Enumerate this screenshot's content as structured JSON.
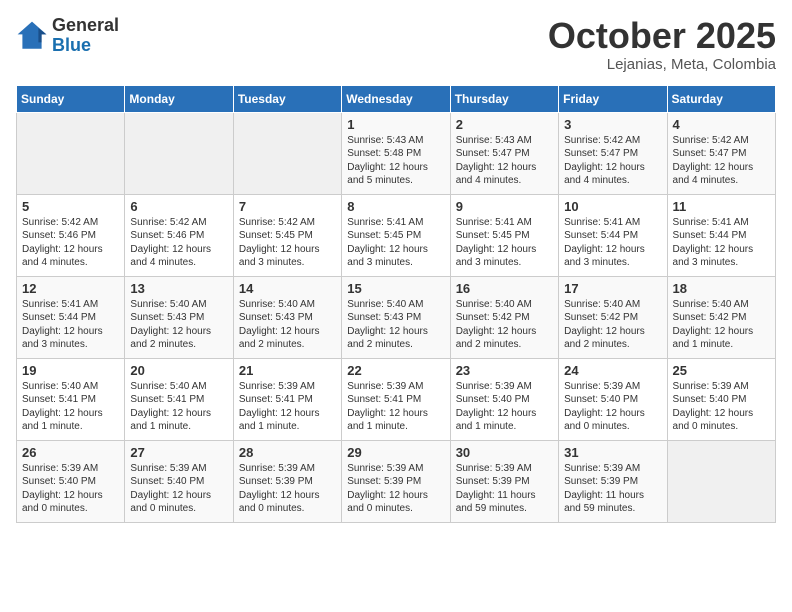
{
  "logo": {
    "general": "General",
    "blue": "Blue"
  },
  "header": {
    "month": "October 2025",
    "location": "Lejanias, Meta, Colombia"
  },
  "weekdays": [
    "Sunday",
    "Monday",
    "Tuesday",
    "Wednesday",
    "Thursday",
    "Friday",
    "Saturday"
  ],
  "weeks": [
    [
      {
        "day": "",
        "content": ""
      },
      {
        "day": "",
        "content": ""
      },
      {
        "day": "",
        "content": ""
      },
      {
        "day": "1",
        "content": "Sunrise: 5:43 AM\nSunset: 5:48 PM\nDaylight: 12 hours\nand 5 minutes."
      },
      {
        "day": "2",
        "content": "Sunrise: 5:43 AM\nSunset: 5:47 PM\nDaylight: 12 hours\nand 4 minutes."
      },
      {
        "day": "3",
        "content": "Sunrise: 5:42 AM\nSunset: 5:47 PM\nDaylight: 12 hours\nand 4 minutes."
      },
      {
        "day": "4",
        "content": "Sunrise: 5:42 AM\nSunset: 5:47 PM\nDaylight: 12 hours\nand 4 minutes."
      }
    ],
    [
      {
        "day": "5",
        "content": "Sunrise: 5:42 AM\nSunset: 5:46 PM\nDaylight: 12 hours\nand 4 minutes."
      },
      {
        "day": "6",
        "content": "Sunrise: 5:42 AM\nSunset: 5:46 PM\nDaylight: 12 hours\nand 4 minutes."
      },
      {
        "day": "7",
        "content": "Sunrise: 5:42 AM\nSunset: 5:45 PM\nDaylight: 12 hours\nand 3 minutes."
      },
      {
        "day": "8",
        "content": "Sunrise: 5:41 AM\nSunset: 5:45 PM\nDaylight: 12 hours\nand 3 minutes."
      },
      {
        "day": "9",
        "content": "Sunrise: 5:41 AM\nSunset: 5:45 PM\nDaylight: 12 hours\nand 3 minutes."
      },
      {
        "day": "10",
        "content": "Sunrise: 5:41 AM\nSunset: 5:44 PM\nDaylight: 12 hours\nand 3 minutes."
      },
      {
        "day": "11",
        "content": "Sunrise: 5:41 AM\nSunset: 5:44 PM\nDaylight: 12 hours\nand 3 minutes."
      }
    ],
    [
      {
        "day": "12",
        "content": "Sunrise: 5:41 AM\nSunset: 5:44 PM\nDaylight: 12 hours\nand 3 minutes."
      },
      {
        "day": "13",
        "content": "Sunrise: 5:40 AM\nSunset: 5:43 PM\nDaylight: 12 hours\nand 2 minutes."
      },
      {
        "day": "14",
        "content": "Sunrise: 5:40 AM\nSunset: 5:43 PM\nDaylight: 12 hours\nand 2 minutes."
      },
      {
        "day": "15",
        "content": "Sunrise: 5:40 AM\nSunset: 5:43 PM\nDaylight: 12 hours\nand 2 minutes."
      },
      {
        "day": "16",
        "content": "Sunrise: 5:40 AM\nSunset: 5:42 PM\nDaylight: 12 hours\nand 2 minutes."
      },
      {
        "day": "17",
        "content": "Sunrise: 5:40 AM\nSunset: 5:42 PM\nDaylight: 12 hours\nand 2 minutes."
      },
      {
        "day": "18",
        "content": "Sunrise: 5:40 AM\nSunset: 5:42 PM\nDaylight: 12 hours\nand 1 minute."
      }
    ],
    [
      {
        "day": "19",
        "content": "Sunrise: 5:40 AM\nSunset: 5:41 PM\nDaylight: 12 hours\nand 1 minute."
      },
      {
        "day": "20",
        "content": "Sunrise: 5:40 AM\nSunset: 5:41 PM\nDaylight: 12 hours\nand 1 minute."
      },
      {
        "day": "21",
        "content": "Sunrise: 5:39 AM\nSunset: 5:41 PM\nDaylight: 12 hours\nand 1 minute."
      },
      {
        "day": "22",
        "content": "Sunrise: 5:39 AM\nSunset: 5:41 PM\nDaylight: 12 hours\nand 1 minute."
      },
      {
        "day": "23",
        "content": "Sunrise: 5:39 AM\nSunset: 5:40 PM\nDaylight: 12 hours\nand 1 minute."
      },
      {
        "day": "24",
        "content": "Sunrise: 5:39 AM\nSunset: 5:40 PM\nDaylight: 12 hours\nand 0 minutes."
      },
      {
        "day": "25",
        "content": "Sunrise: 5:39 AM\nSunset: 5:40 PM\nDaylight: 12 hours\nand 0 minutes."
      }
    ],
    [
      {
        "day": "26",
        "content": "Sunrise: 5:39 AM\nSunset: 5:40 PM\nDaylight: 12 hours\nand 0 minutes."
      },
      {
        "day": "27",
        "content": "Sunrise: 5:39 AM\nSunset: 5:40 PM\nDaylight: 12 hours\nand 0 minutes."
      },
      {
        "day": "28",
        "content": "Sunrise: 5:39 AM\nSunset: 5:39 PM\nDaylight: 12 hours\nand 0 minutes."
      },
      {
        "day": "29",
        "content": "Sunrise: 5:39 AM\nSunset: 5:39 PM\nDaylight: 12 hours\nand 0 minutes."
      },
      {
        "day": "30",
        "content": "Sunrise: 5:39 AM\nSunset: 5:39 PM\nDaylight: 11 hours\nand 59 minutes."
      },
      {
        "day": "31",
        "content": "Sunrise: 5:39 AM\nSunset: 5:39 PM\nDaylight: 11 hours\nand 59 minutes."
      },
      {
        "day": "",
        "content": ""
      }
    ]
  ]
}
